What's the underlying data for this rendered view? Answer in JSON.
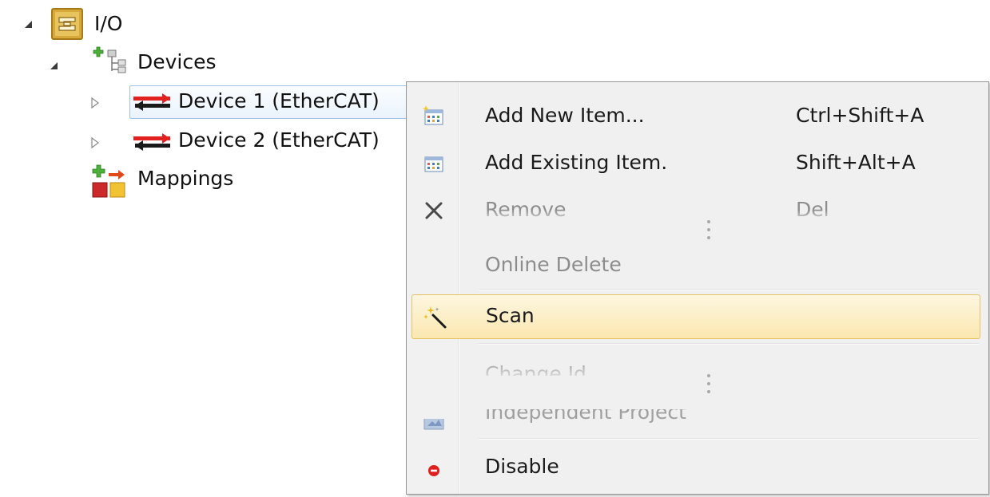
{
  "tree": {
    "root": {
      "label": "I/O",
      "icon": "io-folder-icon",
      "expanded": true
    },
    "devices": {
      "label": "Devices",
      "icon": "devices-tree-icon",
      "expanded": true
    },
    "device1": {
      "label": "Device 1 (EtherCAT)",
      "icon": "ethercat-device-icon",
      "expanded": false,
      "selected": true
    },
    "device2": {
      "label": "Device 2 (EtherCAT)",
      "icon": "ethercat-device-icon",
      "expanded": false
    },
    "mappings": {
      "label": "Mappings",
      "icon": "mappings-icon"
    }
  },
  "context_menu": {
    "items": [
      {
        "label": "Add New Item...",
        "shortcut": "Ctrl+Shift+A",
        "icon": "add-new-item-icon",
        "enabled": true
      },
      {
        "label": "Add Existing Item.",
        "shortcut": "Shift+Alt+A",
        "icon": "add-existing-item-icon",
        "enabled": true
      },
      {
        "label": "Remove",
        "shortcut": "Del",
        "icon": "remove-x-icon",
        "enabled": false
      },
      {
        "label": "Online Delete",
        "shortcut": "",
        "icon": "",
        "enabled": false
      },
      {
        "label": "Scan",
        "shortcut": "",
        "icon": "scan-wand-icon",
        "enabled": true,
        "highlighted": true
      },
      {
        "label": "Change Id",
        "shortcut": "",
        "icon": "",
        "enabled": false
      },
      {
        "label": "Independent Project",
        "shortcut": "",
        "icon": "independent-project-icon",
        "enabled": false
      },
      {
        "label": "Disable",
        "shortcut": "",
        "icon": "disable-icon",
        "enabled": true
      }
    ]
  },
  "colors": {
    "highlight_fill": "#fbe8b0",
    "highlight_border": "#e5c365",
    "selection_border": "#9cc3e6",
    "menu_background": "#f0f0f0",
    "disabled_text": "#8d8d8d",
    "disable_icon_red": "#e0201c"
  }
}
